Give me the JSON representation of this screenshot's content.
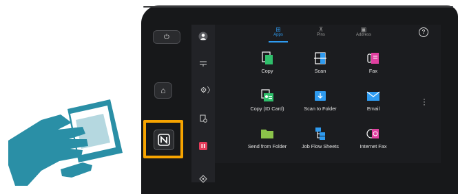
{
  "panel": {
    "tabs": [
      {
        "label": "Apps",
        "icon": "apps-grid-icon",
        "active": true
      },
      {
        "label": "Pins",
        "icon": "pin-icon",
        "active": false
      },
      {
        "label": "Address",
        "icon": "address-book-icon",
        "active": false
      }
    ],
    "apps": [
      {
        "label": "Copy",
        "icon": "copy-icon",
        "color": "#2fbf6b"
      },
      {
        "label": "Scan",
        "icon": "scan-icon",
        "color": "#2f9bf0"
      },
      {
        "label": "Fax",
        "icon": "fax-icon",
        "color": "#e040a0"
      },
      {
        "label": "Copy (ID Card)",
        "icon": "id-card-icon",
        "color": "#2fbf6b"
      },
      {
        "label": "Scan to Folder",
        "icon": "scan-to-folder-icon",
        "color": "#2f9bf0"
      },
      {
        "label": "Email",
        "icon": "email-icon",
        "color": "#2f9bf0"
      },
      {
        "label": "Send from Folder",
        "icon": "send-from-folder-icon",
        "color": "#8bc34a"
      },
      {
        "label": "Job Flow Sheets",
        "icon": "job-flow-icon",
        "color": "#2f9bf0"
      },
      {
        "label": "Internet Fax",
        "icon": "internet-fax-icon",
        "color": "#e040a0"
      }
    ]
  },
  "hardware": {
    "power_label": "⏻",
    "home_label": "⌂"
  },
  "colors": {
    "nfc_highlight": "#f7a400",
    "illustration": "#2a8fa6",
    "accent": "#2f9bf0"
  }
}
